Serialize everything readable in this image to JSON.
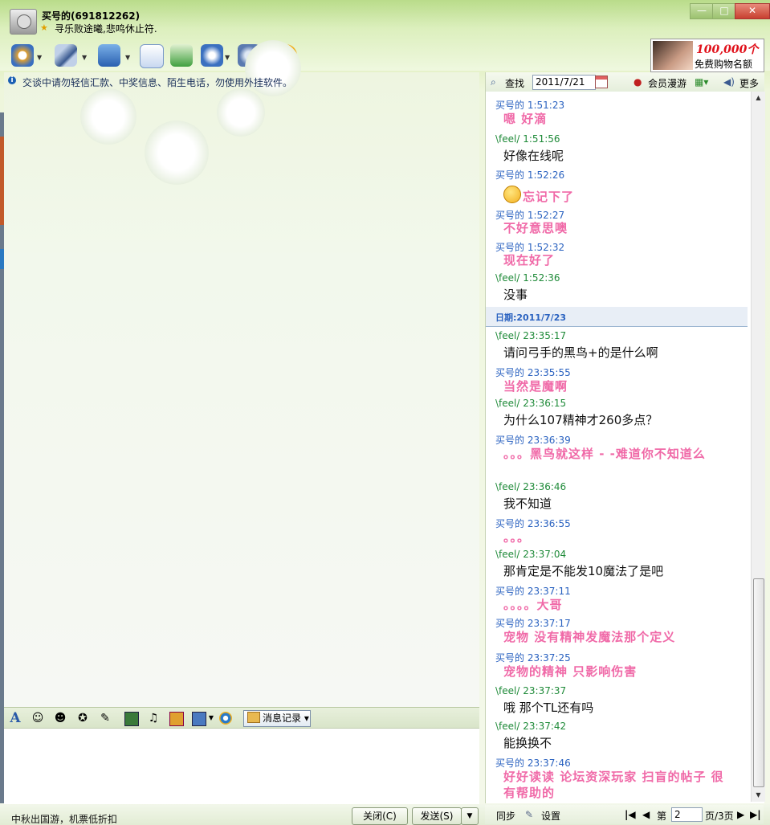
{
  "window": {
    "contact_name": "买号的(691812262)",
    "signature": "寻乐败途曦,悲鸣休止符.",
    "min_glyph": "—",
    "max_glyph": "□",
    "close_glyph": "✕"
  },
  "toolbar": {
    "icons": [
      "video-call-icon",
      "voice-call-icon",
      "send-file-icon",
      "email-icon",
      "add-app-icon",
      "remote-assist-icon",
      "settings-icon",
      "soso-icon"
    ]
  },
  "ad": {
    "number": "100,000个",
    "text": "免费购物名额"
  },
  "notice": "交谈中请勿轻信汇款、中奖信息、陌生电话，勿使用外挂软件。",
  "input_toolbar": {
    "font_glyph": "A",
    "history_label": "消息记录"
  },
  "bottom": {
    "ad_link": "中秋出国游，机票低折扣",
    "close_label": "关闭(C)",
    "send_label": "发送(S)",
    "send_arrow": "▼"
  },
  "history_toolbar": {
    "find_label": "查找",
    "date_value": "2011/7/21",
    "roam_label": "会员漫游",
    "more_label": "更多"
  },
  "messages_day1": [
    {
      "sender": "买号的",
      "time": "1:51:23",
      "text": "嗯  好滴",
      "me": true
    },
    {
      "sender": "\\feel/",
      "time": "1:51:56",
      "text": "好像在线呢",
      "me": false
    },
    {
      "sender": "买号的",
      "time": "1:52:26",
      "text": "忘记下了",
      "me": true,
      "emoji": true
    },
    {
      "sender": "买号的",
      "time": "1:52:27",
      "text": "不好意思噢",
      "me": true
    },
    {
      "sender": "买号的",
      "time": "1:52:32",
      "text": "现在好了",
      "me": true
    },
    {
      "sender": "\\feel/",
      "time": "1:52:36",
      "text": "没事",
      "me": false
    }
  ],
  "day_separator": "日期:2011/7/23",
  "messages_day2": [
    {
      "sender": "\\feel/",
      "time": "23:35:17",
      "text": "请问弓手的黑鸟+的是什么啊",
      "me": false
    },
    {
      "sender": "买号的",
      "time": "23:35:55",
      "text": "当然是魔啊",
      "me": true
    },
    {
      "sender": "\\feel/",
      "time": "23:36:15",
      "text": "为什么107精神才260多点？",
      "me": false
    },
    {
      "sender": "买号的",
      "time": "23:36:39",
      "text": "。。。黑鸟就这样 - -难道你不知道么",
      "me": true
    },
    {
      "sender": "\\feel/",
      "time": "23:36:46",
      "text": "我不知道",
      "me": false
    },
    {
      "sender": "买号的",
      "time": "23:36:55",
      "text": "。。。",
      "me": true
    },
    {
      "sender": "\\feel/",
      "time": "23:37:04",
      "text": "那肯定是不能发10魔法了是吧",
      "me": false
    },
    {
      "sender": "买号的",
      "time": "23:37:11",
      "text": "。。。。大哥",
      "me": true
    },
    {
      "sender": "买号的",
      "time": "23:37:17",
      "text": "宠物 没有精神发魔法那个定义",
      "me": true
    },
    {
      "sender": "买号的",
      "time": "23:37:25",
      "text": "宠物的精神 只影响伤害",
      "me": true
    },
    {
      "sender": "\\feel/",
      "time": "23:37:37",
      "text": "哦  那个TL还有吗",
      "me": false
    },
    {
      "sender": "\\feel/",
      "time": "23:37:42",
      "text": "能换换不",
      "me": false
    },
    {
      "sender": "买号的",
      "time": "23:37:46",
      "text": "好好读读 论坛资深玩家 扫盲的帖子 很有帮助的",
      "me": true
    }
  ],
  "history_footer": {
    "sync_label": "同步",
    "settings_label": "设置",
    "page_prefix": "第",
    "page_value": "2",
    "page_suffix": "页/3页"
  }
}
